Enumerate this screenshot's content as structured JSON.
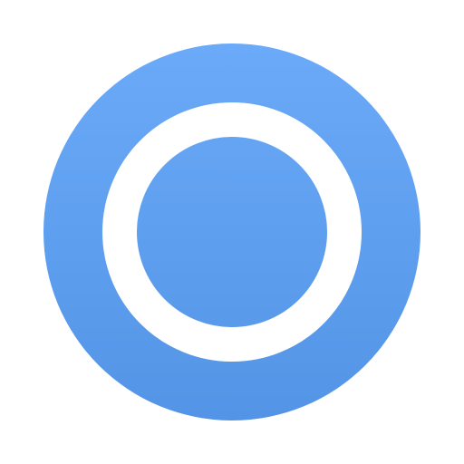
{
  "icon": {
    "name": "ring-logo-icon",
    "colors": {
      "background": "#ffffff",
      "disc_top": "#6aaaf8",
      "disc_bottom": "#5494e6",
      "ring": "#ffffff"
    }
  }
}
